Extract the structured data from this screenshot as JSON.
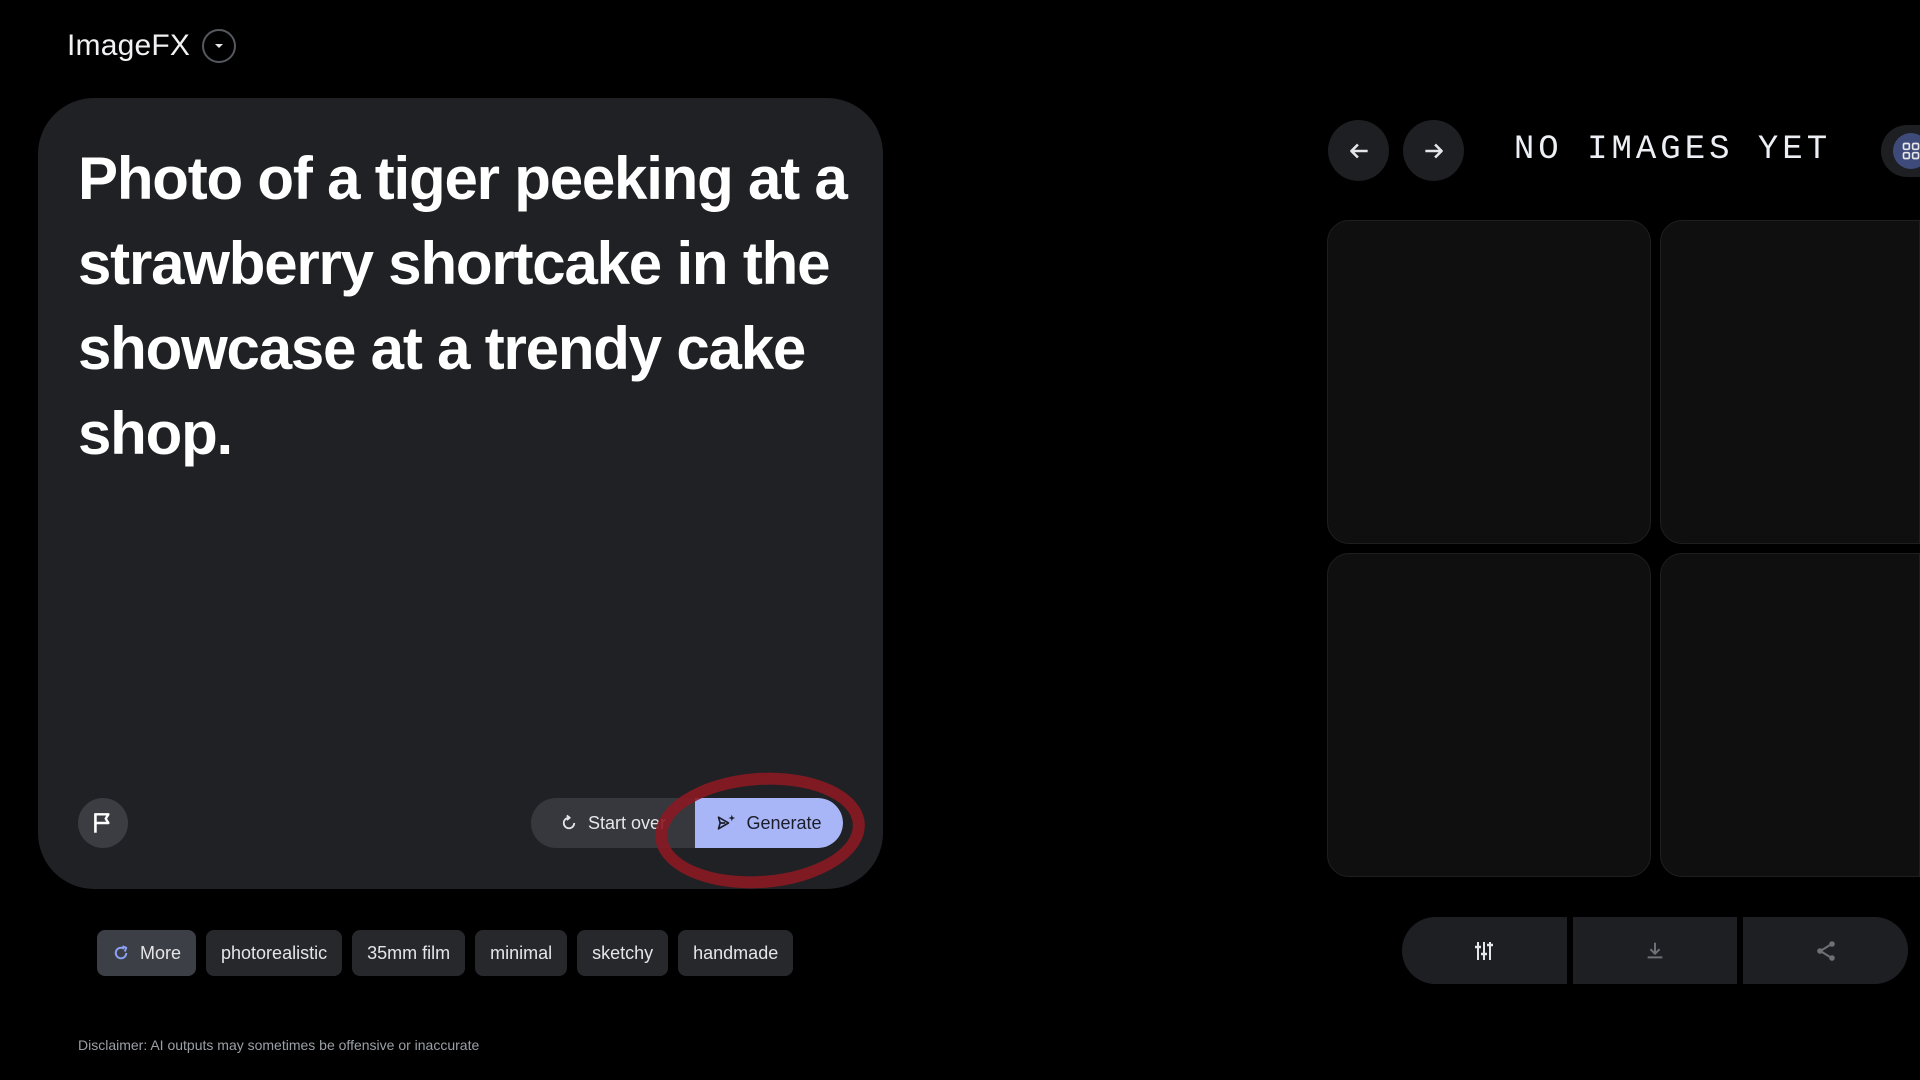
{
  "app": {
    "name": "ImageFX",
    "switcher_icon": "chevron-down-icon"
  },
  "prompt": {
    "text": "Photo of a tiger peeking at a strawberry shortcake in the showcase at a trendy cake shop.",
    "report_icon": "flag-icon",
    "start_over_label": "Start over",
    "start_over_icon": "reset-icon",
    "generate_label": "Generate",
    "generate_icon": "sparkle-send-icon",
    "accent_color": "#a8b6f8"
  },
  "style_chips": {
    "more_label": "More",
    "more_icon": "refresh-icon",
    "items": [
      "photorealistic",
      "35mm film",
      "minimal",
      "sketchy",
      "handmade"
    ]
  },
  "disclaimer": "Disclaimer: AI outputs may sometimes be offensive or inaccurate",
  "results": {
    "status": "NO IMAGES YET",
    "prev_icon": "arrow-left-icon",
    "next_icon": "arrow-right-icon",
    "view_icon": "grid-view-icon",
    "tile_count": 4
  },
  "toolbar": {
    "items": [
      "settings-sliders-icon",
      "download-icon",
      "share-icon"
    ]
  },
  "annotation": {
    "highlight_color": "#8a1a24"
  }
}
